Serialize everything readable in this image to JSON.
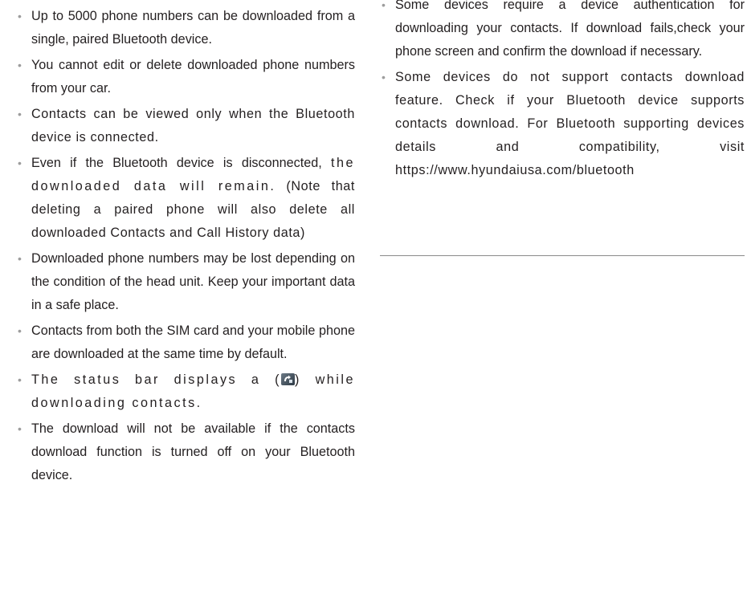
{
  "left_column": {
    "items": [
      "Up to 5000 phone numbers can be downloaded from a single, paired Bluetooth device.",
      "You cannot edit or delete downloaded phone numbers from your car.",
      "Contacts can be viewed only when the Bluetooth device is connected.",
      "Even if the Bluetooth device is disconnected,",
      "Downloaded phone numbers may be lost depending on the condition of the head unit. Keep your important data in a safe place.",
      "Contacts from both the SIM card and your mobile phone are downloaded at the same time by default.",
      "The download will not be available if the contacts download function is turned off on your Bluetooth device."
    ],
    "item4_line2": "the downloaded data will remain.",
    "item4_line3": "(Note that deleting a paired phone will also delete all downloaded Contacts and Call History data)",
    "status_item": {
      "before": "The status bar displays a (",
      "icon": "contacts-download-icon",
      "after": ") while downloading contacts."
    }
  },
  "right_column": {
    "items": [
      "Some devices require a device authentication for downloading your contacts. If download fails,check your phone screen and confirm the download if necessary.",
      "Some devices do not support contacts download feature. Check if your Bluetooth device supports contacts download. For Bluetooth supporting devices details and compatibility, visit https://www.hyundaiusa.com/bluetooth"
    ]
  },
  "bullet_char": "•",
  "colors": {
    "text": "#231f20",
    "bullet": "#9d9d9d",
    "rule": "#8a8a8a"
  }
}
